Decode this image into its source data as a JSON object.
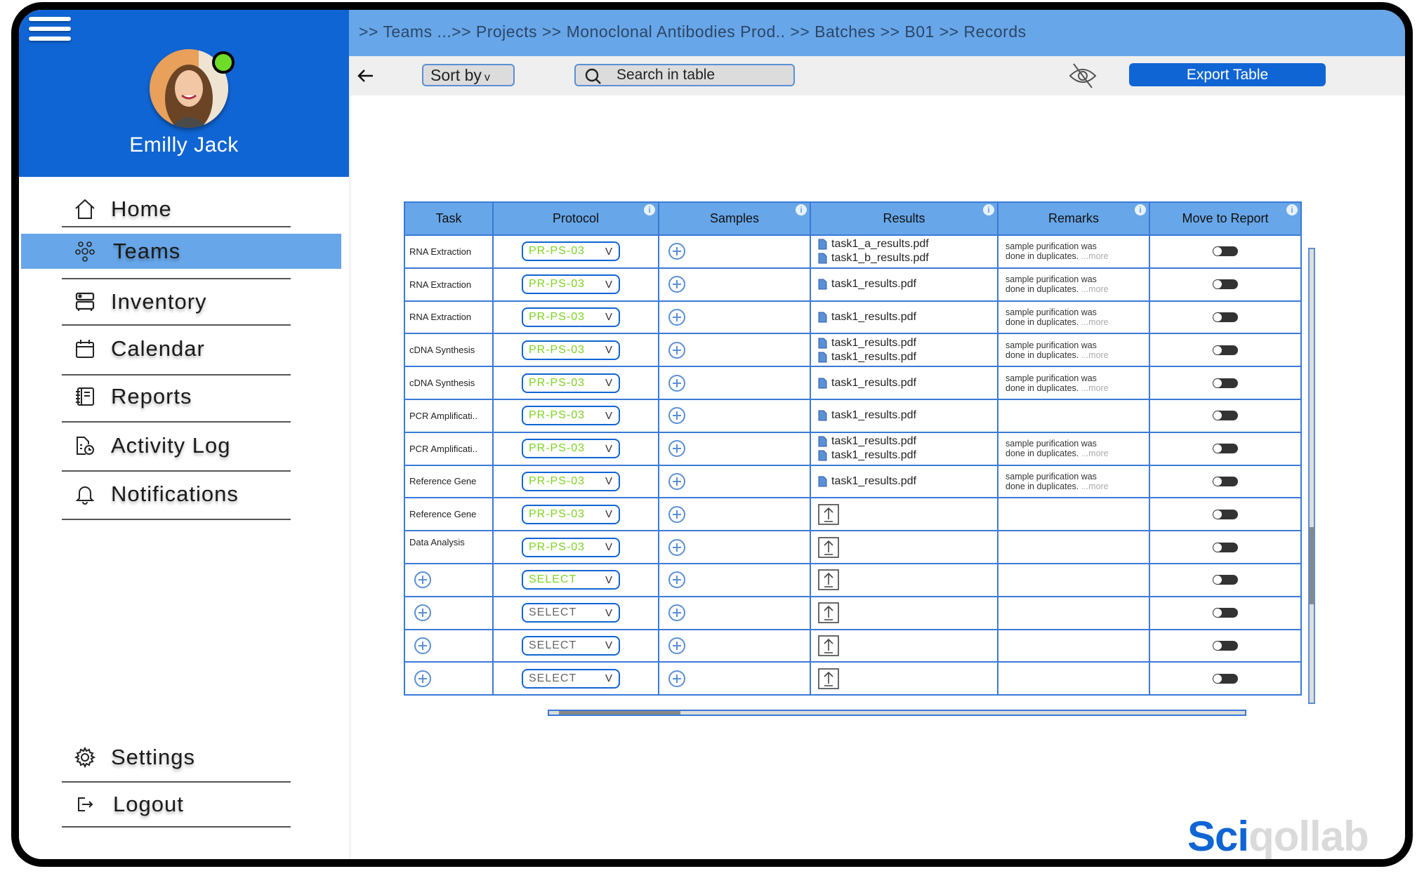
{
  "user": {
    "name": "Emilly Jack",
    "status_color": "#6fdc2a"
  },
  "sidebar": {
    "items": [
      {
        "label": "Home",
        "icon": "home-icon"
      },
      {
        "label": "Teams",
        "icon": "teams-icon",
        "active": true
      },
      {
        "label": "Inventory",
        "icon": "inventory-icon"
      },
      {
        "label": "Calendar",
        "icon": "calendar-icon"
      },
      {
        "label": "Reports",
        "icon": "reports-icon"
      },
      {
        "label": "Activity Log",
        "icon": "activity-log-icon"
      },
      {
        "label": "Notifications",
        "icon": "bell-icon"
      }
    ],
    "bottom_items": [
      {
        "label": "Settings",
        "icon": "gear-icon"
      },
      {
        "label": "Logout",
        "icon": "logout-icon"
      }
    ]
  },
  "breadcrumb": ">> Teams ...>> Projects >> Monoclonal Antibodies Prod.. >> Batches >> B01 >> Records",
  "toolbar": {
    "sort_label": "Sort by",
    "sort_chevron": "v",
    "search_placeholder": "Search in table",
    "export_label": "Export Table"
  },
  "colors": {
    "brand": "#1065d4",
    "header_blue": "#67a6e8",
    "protocol_green": "#7ed321"
  },
  "table": {
    "columns": [
      {
        "label": "Task",
        "info": false
      },
      {
        "label": "Protocol",
        "info": true
      },
      {
        "label": "Samples",
        "info": true
      },
      {
        "label": "Results",
        "info": true
      },
      {
        "label": "Remarks",
        "info": true
      },
      {
        "label": "Move to Report",
        "info": true
      }
    ],
    "info_glyph": "i",
    "remark_more": "...more",
    "rows": [
      {
        "task": "RNA Extraction",
        "protocol": "PR-PS-03",
        "results": [
          "task1_a_results.pdf",
          "task1_b_results.pdf"
        ],
        "remarks": [
          "sample purification was",
          "done in duplicates."
        ],
        "move_to_report": false
      },
      {
        "task": "RNA Extraction",
        "protocol": "PR-PS-03",
        "results": [
          "task1_results.pdf"
        ],
        "remarks": [
          "sample purification was",
          "done in duplicates."
        ],
        "move_to_report": false
      },
      {
        "task": "RNA Extraction",
        "protocol": "PR-PS-03",
        "results": [
          "task1_results.pdf"
        ],
        "remarks": [
          "sample purification was",
          "done in duplicates."
        ],
        "move_to_report": false
      },
      {
        "task": "cDNA Synthesis",
        "protocol": "PR-PS-03",
        "results": [
          "task1_results.pdf",
          "task1_results.pdf"
        ],
        "remarks": [
          "sample purification was",
          "done in duplicates."
        ],
        "move_to_report": false
      },
      {
        "task": "cDNA Synthesis",
        "protocol": "PR-PS-03",
        "results": [
          "task1_results.pdf"
        ],
        "remarks": [
          "sample purification was",
          "done in duplicates."
        ],
        "move_to_report": false
      },
      {
        "task": "PCR Amplificati..",
        "protocol": "PR-PS-03",
        "results": [
          "task1_results.pdf"
        ],
        "remarks": [],
        "move_to_report": false
      },
      {
        "task": "PCR Amplificati..",
        "protocol": "PR-PS-03",
        "results": [
          "task1_results.pdf",
          "task1_results.pdf"
        ],
        "remarks": [
          "sample purification was",
          "done in duplicates."
        ],
        "move_to_report": false
      },
      {
        "task": "Reference Gene",
        "protocol": "PR-PS-03",
        "results": [
          "task1_results.pdf"
        ],
        "remarks": [
          "sample purification was",
          "done in duplicates."
        ],
        "move_to_report": false
      },
      {
        "task": "Reference Gene",
        "protocol": "PR-PS-03",
        "results": [],
        "remarks": [],
        "move_to_report": false
      },
      {
        "task": "Data Analysis",
        "protocol": "PR-PS-03",
        "results": [],
        "remarks": [],
        "move_to_report": false
      },
      {
        "task": "",
        "protocol": "SELECT",
        "protocol_color": "#7ed321",
        "results": [],
        "remarks": [],
        "move_to_report": false
      },
      {
        "task": "",
        "protocol": "SELECT",
        "protocol_color": "#666666",
        "results": [],
        "remarks": [],
        "move_to_report": false
      },
      {
        "task": "",
        "protocol": "SELECT",
        "protocol_color": "#666666",
        "results": [],
        "remarks": [],
        "move_to_report": false
      },
      {
        "task": "",
        "protocol": "SELECT",
        "protocol_color": "#666666",
        "results": [],
        "remarks": [],
        "move_to_report": false
      }
    ],
    "protocol_chevron": "V"
  },
  "logo": {
    "part1": "Sci",
    "part2": "qollab"
  }
}
